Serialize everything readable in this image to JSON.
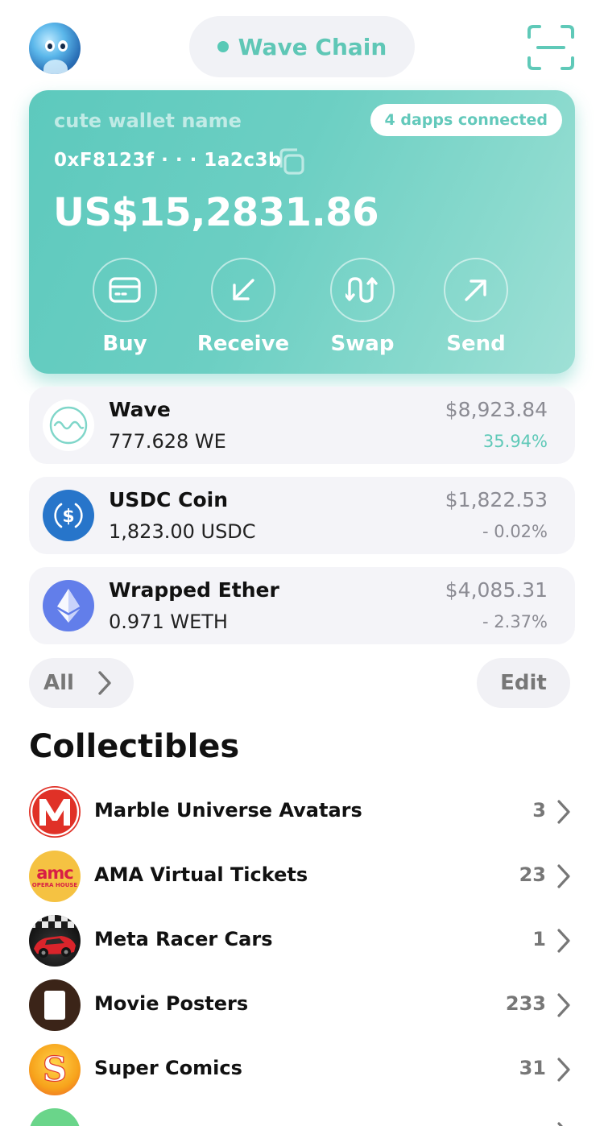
{
  "header": {
    "chain_label": "Wave Chain",
    "chain_dot_color": "#58c9b6"
  },
  "wallet": {
    "name": "cute wallet name",
    "dapps_connected": "4 dapps connected",
    "address": "0xF8123f · · · 1a2c3b",
    "balance": "US$15,2831.86",
    "actions": [
      {
        "label": "Buy",
        "icon": "card-icon"
      },
      {
        "label": "Receive",
        "icon": "arrow-down-left-icon"
      },
      {
        "label": "Swap",
        "icon": "swap-icon"
      },
      {
        "label": "Send",
        "icon": "arrow-up-right-icon"
      }
    ]
  },
  "tokens": [
    {
      "name": "Wave",
      "amount": "777.628 WE",
      "value": "$8,923.84",
      "change": "35.94%",
      "positive": true
    },
    {
      "name": "USDC Coin",
      "amount": "1,823.00 USDC",
      "value": "$1,822.53",
      "change": "- 0.02%",
      "positive": false
    },
    {
      "name": "Wrapped Ether",
      "amount": "0.971 WETH",
      "value": "$4,085.31",
      "change": "- 2.37%",
      "positive": false
    }
  ],
  "filters": {
    "all_label": "All",
    "edit_label": "Edit"
  },
  "collectibles": {
    "title": "Collectibles",
    "items": [
      {
        "name": "Marble Universe Avatars",
        "count": "3"
      },
      {
        "name": "AMA Virtual Tickets",
        "count": "23",
        "logo_text": "amc",
        "logo_subtext": "OPERA HOUSE"
      },
      {
        "name": "Meta Racer Cars",
        "count": "1"
      },
      {
        "name": "Movie Posters",
        "count": "233"
      },
      {
        "name": "Super Comics",
        "count": "31"
      }
    ]
  },
  "colors": {
    "accent": "#5fc9b8",
    "card_gradient_start": "#5dc9bd",
    "card_gradient_end": "#9fe0d6",
    "usdc_blue": "#2775ca",
    "eth_purple": "#627eea",
    "marble_red": "#e03127"
  }
}
